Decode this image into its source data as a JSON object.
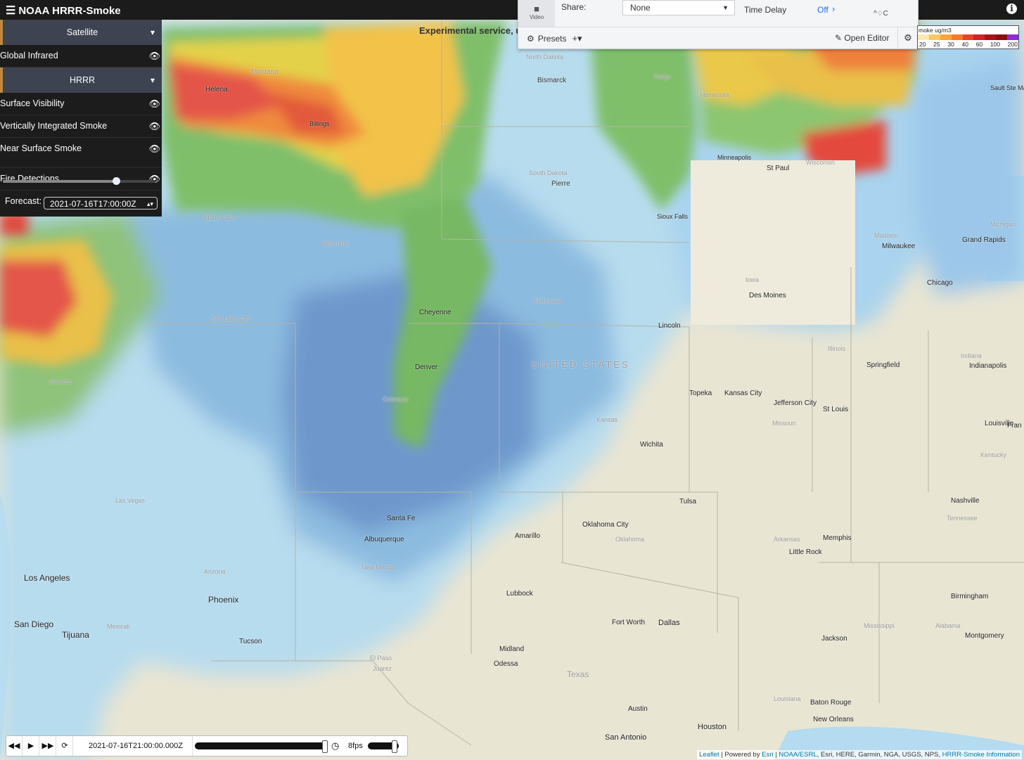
{
  "app": {
    "title": "NOAA HRRR-Smoke"
  },
  "sidebar": {
    "satellite_group": "Satellite",
    "satellite_layers": [
      {
        "label": "Global Infrared"
      }
    ],
    "hrrr_group": "HRRR",
    "hrrr_layers": [
      {
        "label": "Surface Visibility"
      },
      {
        "label": "Vertically Integrated Smoke"
      },
      {
        "label": "Near Surface Smoke"
      },
      {
        "label": "Fire Detections"
      }
    ],
    "opacity_level": 0.74,
    "forecast_label": "Forecast:",
    "forecast_value": "2021-07-16T17:00:00Z"
  },
  "share_panel": {
    "video_label": "Video",
    "share_label": "Share:",
    "share_value": "None",
    "time_delay_label": "Time Delay",
    "time_delay_value": "Off",
    "symbol_text": "^♢C",
    "presets_label": "Presets",
    "open_editor_label": "Open Editor"
  },
  "banner": {
    "text": "Experimental service, u"
  },
  "legend": {
    "title": "moke ug/m3",
    "colors": [
      "#fde7b0",
      "#fcc663",
      "#f9a53a",
      "#f57a2a",
      "#e8432a",
      "#d02424",
      "#a8131a",
      "#8b0f12",
      "#8e2bd4"
    ],
    "ticks": [
      "20",
      "25",
      "30",
      "40",
      "60",
      "100",
      "200"
    ]
  },
  "map_labels": [
    {
      "text": "North Dakota"
    },
    {
      "text": "Bismarck"
    },
    {
      "text": "Fargo"
    },
    {
      "text": "Minnesota"
    },
    {
      "text": "Montana"
    },
    {
      "text": "Helena"
    },
    {
      "text": "Billings"
    },
    {
      "text": "South Dakota"
    },
    {
      "text": "Pierre"
    },
    {
      "text": "Sioux Falls"
    },
    {
      "text": "Minneapolis"
    },
    {
      "text": "St Paul"
    },
    {
      "text": "Wisconsin"
    },
    {
      "text": "Iowa"
    },
    {
      "text": "Des Moines"
    },
    {
      "text": "Madison"
    },
    {
      "text": "Milwaukee"
    },
    {
      "text": "Michigan"
    },
    {
      "text": "Grand Rapids"
    },
    {
      "text": "Chicago"
    },
    {
      "text": "Idaho Falls"
    },
    {
      "text": "Wyoming"
    },
    {
      "text": "Cheyenne"
    },
    {
      "text": "Salt Lake City"
    },
    {
      "text": "Nebraska"
    },
    {
      "text": "Lincoln"
    },
    {
      "text": "UNITED STATES"
    },
    {
      "text": "Illinois"
    },
    {
      "text": "Springfield"
    },
    {
      "text": "Indiana"
    },
    {
      "text": "Indianapolis"
    },
    {
      "text": "Denver"
    },
    {
      "text": "Colorado"
    },
    {
      "text": "Topeka"
    },
    {
      "text": "Kansas City"
    },
    {
      "text": "Jefferson City"
    },
    {
      "text": "St Louis"
    },
    {
      "text": "Missouri"
    },
    {
      "text": "Louisville"
    },
    {
      "text": "Kentucky"
    },
    {
      "text": "Kansas"
    },
    {
      "text": "Wichita"
    },
    {
      "text": "Nevada"
    },
    {
      "text": "Las Vegas"
    },
    {
      "text": "Tulsa"
    },
    {
      "text": "Oklahoma City"
    },
    {
      "text": "Oklahoma"
    },
    {
      "text": "Nashville"
    },
    {
      "text": "Tennessee"
    },
    {
      "text": "Santa Fe"
    },
    {
      "text": "Albuquerque"
    },
    {
      "text": "New Mexico"
    },
    {
      "text": "Amarillo"
    },
    {
      "text": "Arkansas"
    },
    {
      "text": "Memphis"
    },
    {
      "text": "Little Rock"
    },
    {
      "text": "Los Angeles"
    },
    {
      "text": "Arizona"
    },
    {
      "text": "Phoenix"
    },
    {
      "text": "Lubbock"
    },
    {
      "text": "Birmingham"
    },
    {
      "text": "San Diego"
    },
    {
      "text": "Tijuana"
    },
    {
      "text": "Mexicali"
    },
    {
      "text": "Tucson"
    },
    {
      "text": "Fort Worth"
    },
    {
      "text": "Dallas"
    },
    {
      "text": "Mississippi"
    },
    {
      "text": "Alabama"
    },
    {
      "text": "Montgomery"
    },
    {
      "text": "Jackson"
    },
    {
      "text": "El Paso"
    },
    {
      "text": "Juarez"
    },
    {
      "text": "Midland"
    },
    {
      "text": "Odessa"
    },
    {
      "text": "Texas"
    },
    {
      "text": "Louisiana"
    },
    {
      "text": "Baton Rouge"
    },
    {
      "text": "New Orleans"
    },
    {
      "text": "Austin"
    },
    {
      "text": "Houston"
    },
    {
      "text": "San Antonio"
    },
    {
      "text": "Sault Ste Marie"
    },
    {
      "text": "Fran"
    }
  ],
  "timeline": {
    "date": "2021-07-16T21:00:00.000Z",
    "fps": "8fps",
    "progress": 1.0
  },
  "attribution": {
    "leaflet": "Leaflet",
    "powered_by": " | Powered by ",
    "esri": "Esri",
    "noaa": "NOAA/ESRL",
    "rest": ", Esri, HERE, Garmin, NGA, USGS, NPS, ",
    "info": "HRRR-Smoke Information"
  }
}
